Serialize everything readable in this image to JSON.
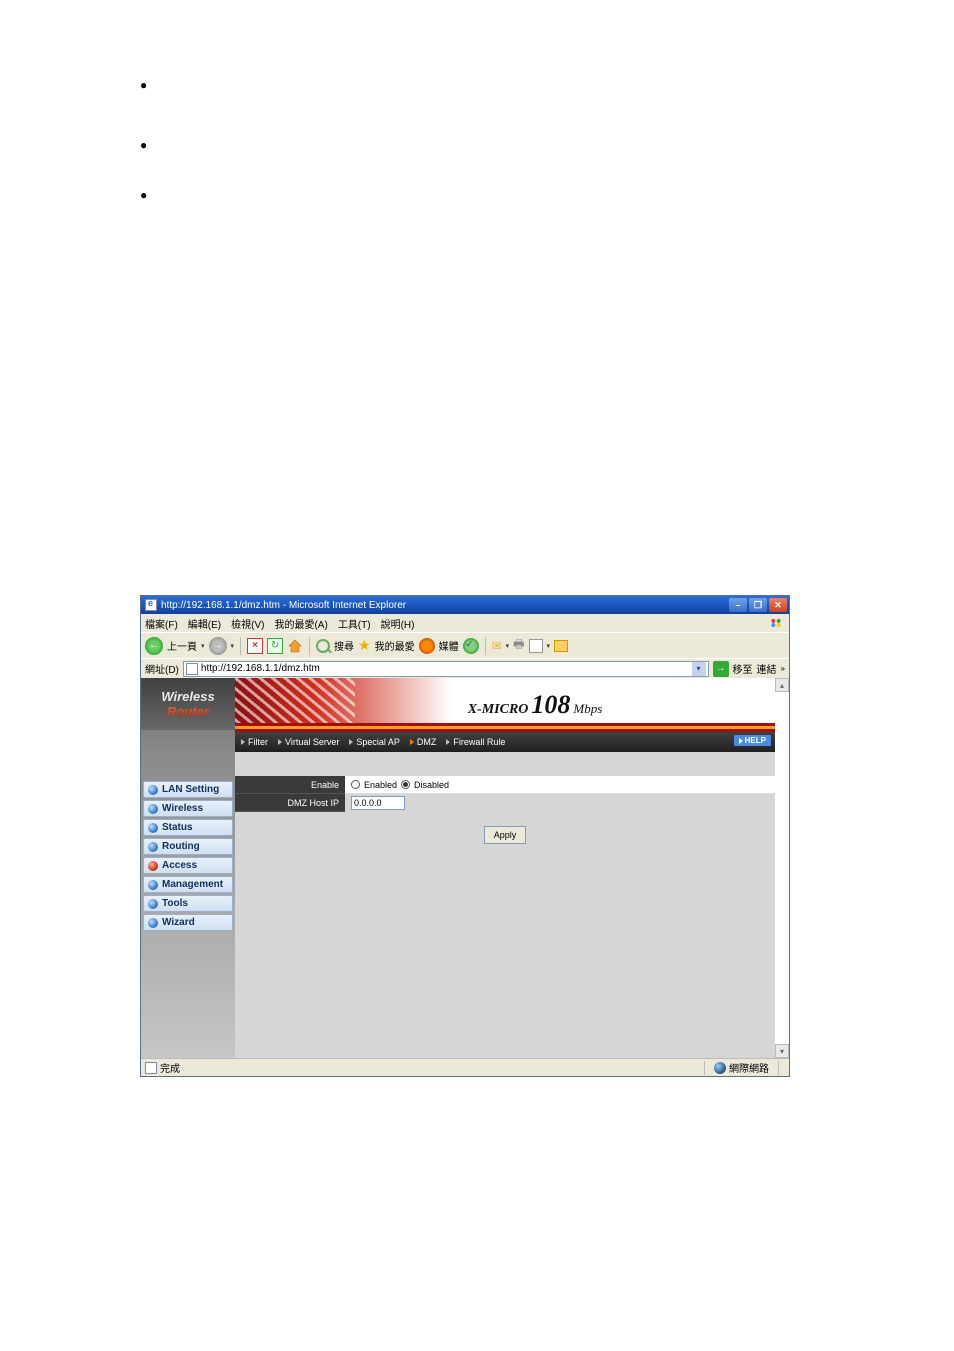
{
  "bullets": [
    "",
    "",
    ""
  ],
  "window": {
    "title": "http://192.168.1.1/dmz.htm - Microsoft Internet Explorer"
  },
  "menubar": {
    "file": "檔案(F)",
    "edit": "編輯(E)",
    "view": "檢視(V)",
    "favorites": "我的最愛(A)",
    "tools": "工具(T)",
    "help": "說明(H)"
  },
  "toolbar": {
    "back": "上一頁",
    "search": "搜尋",
    "favorites": "我的最愛",
    "media": "媒體"
  },
  "addressbar": {
    "label": "網址(D)",
    "url": "http://192.168.1.1/dmz.htm",
    "go": "移至",
    "links": "連結"
  },
  "router": {
    "logo_line1": "Wireless",
    "logo_line2": "Router",
    "brand_prefix": "X-MICRO",
    "brand_big": "108",
    "brand_suffix": "Mbps",
    "subnav": {
      "filter": "Filter",
      "virtual_server": "Virtual Server",
      "special_ap": "Special AP",
      "dmz": "DMZ",
      "firewall_rule": "Firewall Rule",
      "help": "HELP"
    },
    "sidebar": [
      "LAN Setting",
      "Wireless",
      "Status",
      "Routing",
      "Access",
      "Management",
      "Tools",
      "Wizard"
    ],
    "form": {
      "enable_label": "Enable",
      "opt_enabled": "Enabled",
      "opt_disabled": "Disabled",
      "dmz_label": "DMZ Host IP",
      "dmz_value": "0.0.0.0",
      "apply": "Apply"
    }
  },
  "statusbar": {
    "done": "完成",
    "zone": "網際網路"
  }
}
